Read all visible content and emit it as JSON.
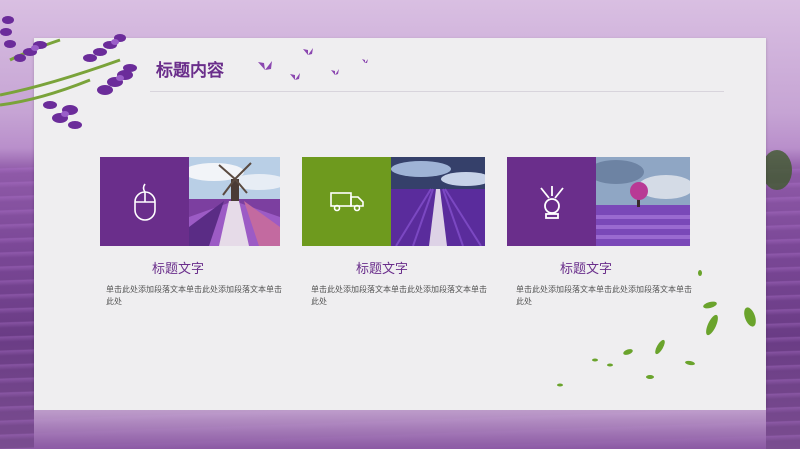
{
  "slide": {
    "title": "标题内容"
  },
  "cards": [
    {
      "title": "标题文字",
      "description": "单击此处添加段落文本单击此处添加段落文本单击此处",
      "icon": "mouse-icon",
      "tile_color": "#6a2e8b"
    },
    {
      "title": "标题文字",
      "description": "单击此处添加段落文本单击此处添加段落文本单击此处",
      "icon": "truck-icon",
      "tile_color": "#6e9a1e"
    },
    {
      "title": "标题文字",
      "description": "单击此处添加段落文本单击此处添加段落文本单击此处",
      "icon": "firewire-icon",
      "tile_color": "#6a2e8b"
    }
  ],
  "colors": {
    "accent_purple": "#6a2e8b",
    "accent_green": "#6e9a1e"
  }
}
